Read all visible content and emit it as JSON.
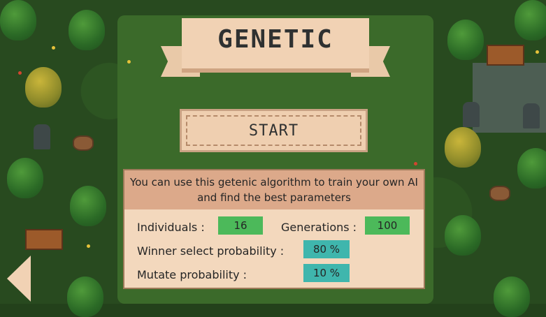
{
  "title": "GENETIC",
  "start_label": "START",
  "description": "You can use this getenic algorithm to train your own AI and find the best parameters",
  "parameters": {
    "individuals": {
      "label": "Individuals :",
      "value": "16"
    },
    "generations": {
      "label": "Generations :",
      "value": "100"
    },
    "winner_select": {
      "label": "Winner select probability :",
      "value": "80 %"
    },
    "mutate": {
      "label": "Mutate probability :",
      "value": "10 %"
    }
  },
  "colors": {
    "accent_green": "#4cb95a",
    "accent_teal": "#3fb6ad",
    "panel": "#f3d8bd"
  },
  "icons": {
    "back": "left-triangle-arrow"
  }
}
